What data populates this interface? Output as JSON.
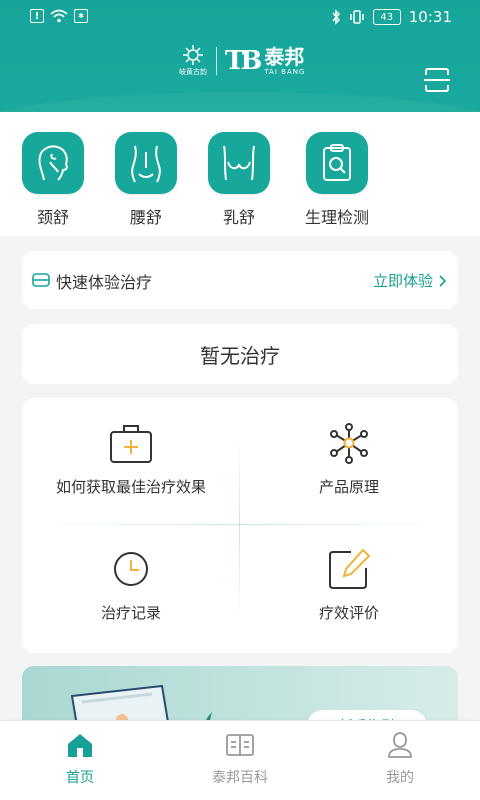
{
  "status_bar": {
    "time": "10:31",
    "battery": "43"
  },
  "header": {
    "brand_cn": "泰邦",
    "brand_en": "TAI BANG",
    "brand_logo": "TB",
    "emblem_text": "岐黄古韵",
    "scan_icon": "scan-icon"
  },
  "categories": [
    {
      "label": "颈舒",
      "icon": "neck-icon"
    },
    {
      "label": "腰舒",
      "icon": "waist-icon"
    },
    {
      "label": "乳舒",
      "icon": "chest-icon"
    },
    {
      "label": "生理检测",
      "icon": "clipboard-search-icon"
    }
  ],
  "quick": {
    "title": "快速体验治疗",
    "action": "立即体验"
  },
  "empty_state": "暂无治疗",
  "grid": [
    {
      "label": "如何获取最佳治疗效果",
      "icon": "medkit-icon"
    },
    {
      "label": "产品原理",
      "icon": "molecule-icon"
    },
    {
      "label": "治疗记录",
      "icon": "clock-icon"
    },
    {
      "label": "疗效评价",
      "icon": "edit-icon"
    }
  ],
  "banner": {
    "pill_text": "新手指引"
  },
  "nav": [
    {
      "label": "首页",
      "icon": "home-icon",
      "active": true
    },
    {
      "label": "泰邦百科",
      "icon": "book-icon",
      "active": false
    },
    {
      "label": "我的",
      "icon": "user-icon",
      "active": false
    }
  ],
  "colors": {
    "primary": "#17a79b",
    "accent_yellow": "#f2b33d",
    "background": "#f2f4f6"
  }
}
